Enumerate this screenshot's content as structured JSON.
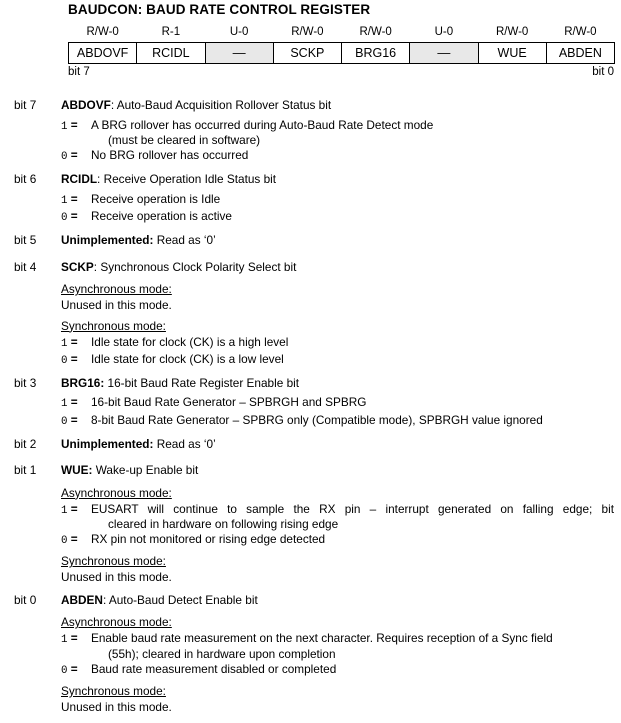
{
  "register": {
    "title": "BAUDCON: BAUD RATE CONTROL REGISTER",
    "bit_high_label": "bit 7",
    "bit_low_label": "bit 0",
    "cells": [
      {
        "access": "R/W-0",
        "name": "ABDOVF",
        "unimplemented": false
      },
      {
        "access": "R-1",
        "name": "RCIDL",
        "unimplemented": false
      },
      {
        "access": "U-0",
        "name": "—",
        "unimplemented": true
      },
      {
        "access": "R/W-0",
        "name": "SCKP",
        "unimplemented": false
      },
      {
        "access": "R/W-0",
        "name": "BRG16",
        "unimplemented": false
      },
      {
        "access": "U-0",
        "name": "—",
        "unimplemented": true
      },
      {
        "access": "R/W-0",
        "name": "WUE",
        "unimplemented": false
      },
      {
        "access": "R/W-0",
        "name": "ABDEN",
        "unimplemented": false
      }
    ]
  },
  "bits": [
    {
      "label": "bit 7",
      "mnemonic": "ABDOVF",
      "description": ": Auto-Baud Acquisition Rollover Status bit",
      "values": [
        {
          "key": "1",
          "text": "A BRG rollover has occurred during Auto-Baud Rate Detect mode",
          "cont": "(must be cleared in software)"
        },
        {
          "key": "0",
          "text": "No BRG rollover has occurred"
        }
      ]
    },
    {
      "label": "bit 6",
      "mnemonic": "RCIDL",
      "description": ": Receive Operation Idle Status bit",
      "values": [
        {
          "key": "1",
          "text": "Receive operation is Idle"
        },
        {
          "key": "0",
          "text": "Receive operation is active"
        }
      ]
    },
    {
      "label": "bit 5",
      "mnemonic": "Unimplemented:",
      "description": " Read as ‘0’",
      "values": []
    },
    {
      "label": "bit 4",
      "mnemonic": "SCKP",
      "description": ": Synchronous Clock Polarity Select bit",
      "modes": [
        {
          "head": "Asynchronous mode:",
          "plain": "Unused in this mode.",
          "values": []
        },
        {
          "head": "Synchronous mode:",
          "values": [
            {
              "key": "1",
              "text": "Idle state for clock (CK) is a high level"
            },
            {
              "key": "0",
              "text": "Idle state for clock (CK) is a low level"
            }
          ]
        }
      ]
    },
    {
      "label": "bit 3",
      "mnemonic": "BRG16:",
      "description": " 16-bit Baud Rate Register Enable bit",
      "values": [
        {
          "key": "1",
          "text": "16-bit Baud Rate Generator – SPBRGH and SPBRG"
        },
        {
          "key": "0",
          "text": "8-bit Baud Rate Generator – SPBRG only (Compatible mode), SPBRGH value ignored"
        }
      ]
    },
    {
      "label": "bit 2",
      "mnemonic": "Unimplemented:",
      "description": " Read as ‘0’",
      "values": []
    },
    {
      "label": "bit 1",
      "mnemonic": "WUE:",
      "description": " Wake-up Enable bit",
      "modes": [
        {
          "head": "Asynchronous mode:",
          "values": [
            {
              "key": "1",
              "text": "EUSART will continue to sample the RX pin – interrupt generated on falling edge; bit",
              "cont": "cleared in hardware on following rising edge",
              "justify": true
            },
            {
              "key": "0",
              "text": "RX pin not monitored or rising edge detected"
            }
          ]
        },
        {
          "head": "Synchronous mode:",
          "plain": "Unused in this mode.",
          "values": []
        }
      ]
    },
    {
      "label": "bit 0",
      "mnemonic": "ABDEN",
      "description": ": Auto-Baud Detect Enable bit",
      "modes": [
        {
          "head": "Asynchronous mode:",
          "values": [
            {
              "key": "1",
              "text": "Enable baud rate measurement on the next character. Requires reception of a Sync field",
              "cont": "(55h); cleared in hardware upon completion"
            },
            {
              "key": "0",
              "text": "Baud rate measurement disabled or completed"
            }
          ]
        },
        {
          "head": "Synchronous mode:",
          "plain": "Unused in this mode.",
          "values": []
        }
      ]
    }
  ]
}
